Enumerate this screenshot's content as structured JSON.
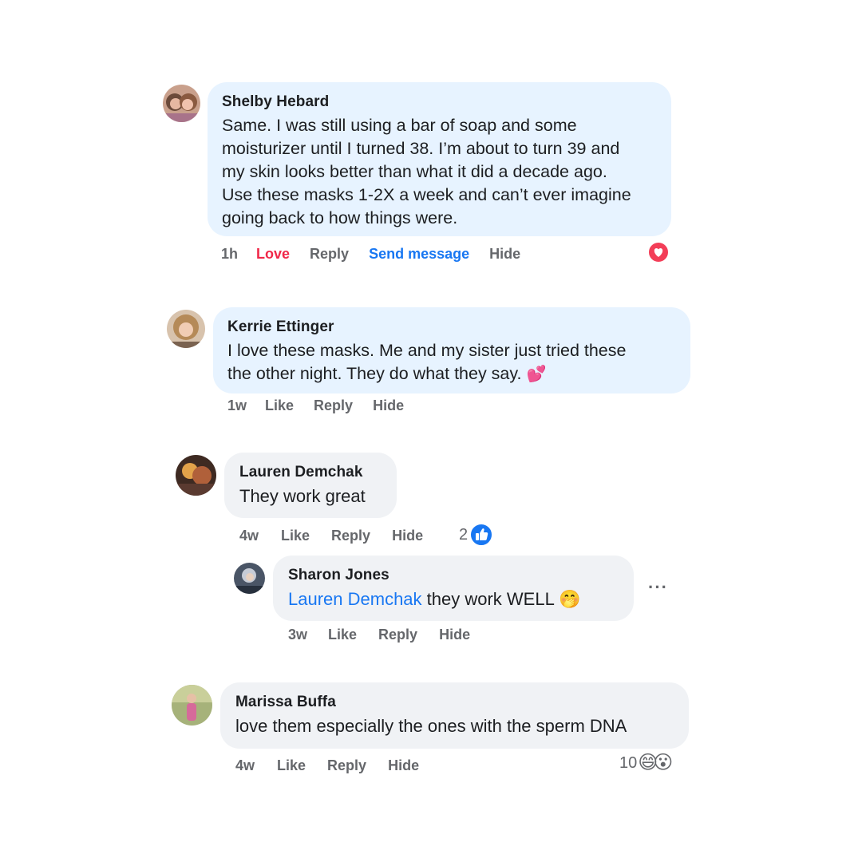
{
  "comments": [
    {
      "author": "Shelby Hebard",
      "text_lines": [
        "Same. I was still using a bar of soap and some",
        "moisturizer until I turned 38. I’m about to turn 39 and",
        "my skin looks better than what it did a decade ago.",
        "Use these masks 1-2X a week and can’t ever imagine",
        "going back to how things were."
      ],
      "time": "1h",
      "like_label": "Love",
      "reply_label": "Reply",
      "send_label": "Send message",
      "hide_label": "Hide",
      "reaction_icon": "heart-reaction-icon"
    },
    {
      "author": "Kerrie Ettinger",
      "text_lines": [
        "I love these masks. Me and my sister just tried these",
        "the other night. They do what they say."
      ],
      "text_emoji": "💕",
      "time": "1w",
      "like_label": "Like",
      "reply_label": "Reply",
      "hide_label": "Hide"
    },
    {
      "author": "Lauren Demchak",
      "text": "They work great",
      "time": "4w",
      "like_label": "Like",
      "reply_label": "Reply",
      "hide_label": "Hide",
      "reaction_count": "2",
      "reaction_icon": "like-reaction-icon"
    },
    {
      "author": "Sharon Jones",
      "mention": "Lauren Demchak",
      "text": " they work WELL ",
      "text_emoji": "🤭",
      "time": "3w",
      "like_label": "Like",
      "reply_label": "Reply",
      "hide_label": "Hide",
      "more_label": "···"
    },
    {
      "author": "Marissa Buffa",
      "text": "love them especially the ones with the sperm DNA",
      "time": "4w",
      "like_label": "Like",
      "reply_label": "Reply",
      "hide_label": "Hide",
      "reaction_count": "10",
      "reaction_emojis": [
        "😄",
        "😮"
      ]
    }
  ],
  "colors": {
    "blue_bubble": "#e7f3ff",
    "gray_bubble": "#f0f2f5",
    "love": "#f02849",
    "link": "#1877f2",
    "meta": "#65676b"
  }
}
